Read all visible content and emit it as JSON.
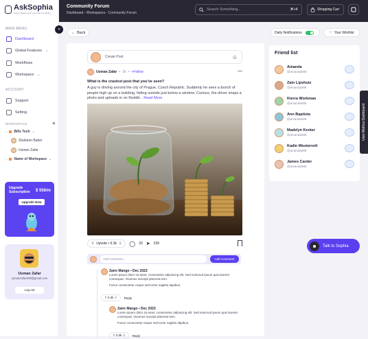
{
  "brand": {
    "name": "AskSophia",
    "tagline": "Inquiry Based New Look New Possibility"
  },
  "sidebar": {
    "main_menu_label": "MAIN MENU",
    "items": [
      {
        "label": "Dashboard",
        "icon": "dashboard-icon",
        "active": true
      },
      {
        "label": "Global Features",
        "icon": "globe-icon"
      },
      {
        "label": "Workflows",
        "icon": "workflow-icon"
      },
      {
        "label": "Workspace",
        "icon": "workspace-icon"
      }
    ],
    "account_label": "ACCOUNT",
    "account_items": [
      {
        "label": "Support",
        "icon": "support-icon"
      },
      {
        "label": "Setting",
        "icon": "gear-icon"
      }
    ],
    "workspace_label": "WORKSPACE",
    "workspaces": [
      {
        "label": "Bills Tech",
        "members": [
          "Shaheen Baber",
          "Usman Zafar"
        ]
      },
      {
        "label": "Name of Workspace"
      }
    ],
    "upgrade": {
      "title": "Upgrade Subscription",
      "price": "$ 556/m",
      "button": "Upgrade Now"
    },
    "user": {
      "name": "Usman Zafar",
      "email": "usmanzafar009@gmail.com",
      "logout": "Log out"
    }
  },
  "topbar": {
    "title": "Community Forum",
    "breadcrumb": "Dashboard - Workspaces - Community Forum",
    "search_placeholder": "Search Something...",
    "search_shortcut": "⌘+K",
    "cart_label": "Shopping Cart"
  },
  "toolbar": {
    "back": "Back",
    "notifications": "Daily Notifications",
    "notifications_on": true,
    "wishlist": "Your Wishlist"
  },
  "feed": {
    "create_post": "Create Post",
    "post": {
      "author": "Usman Zafar",
      "time": "1h",
      "follow": "Follow",
      "title": "What is the craziest post that you've seen?",
      "body": "A guy is driving around the city of Prague, Czech Republic. Suddenly he sees a bunch of people high up on a building, hiding outside just below a window. Curious, the driver snaps a photo and uploads in on Reddit...",
      "read_more": "Read More",
      "upvotes": "Upvote • 6.3k",
      "comments": "20",
      "shares": "239"
    },
    "comment_placeholder": "Add Comment...",
    "comment_button": "Add Comment",
    "comments": [
      {
        "who": "Zaire Mango • Dec 2023",
        "text": "Lorem ipsum dolor sit amet, consectetur adipiscing elit. Sed euismod ipsum quis laoreet consequat. Vivamus suscipit placerat sem.",
        "text2": "Fusce consectetur neque sed tortor sagittis dapibus.",
        "votes": "5.3k",
        "reply": "Reply"
      },
      {
        "who": "Zaire Mango • Dec 2023",
        "text": "Lorem ipsum dolor sit amet, consectetur adipiscing elit. Sed euismod ipsum quis laoreet consequat. Vivamus suscipit placerat sem.",
        "text2": "Fusce consectetur neque sed tortor sagittis dapibus.",
        "votes": "5.3k",
        "reply": "Reply"
      }
    ]
  },
  "friends": {
    "title": "Friend list",
    "list": [
      {
        "name": "Amanda",
        "handle": "@amanda089"
      },
      {
        "name": "Zain Lipshutz",
        "handle": "@amanda089"
      },
      {
        "name": "Kierra Workman",
        "handle": "@amanda089"
      },
      {
        "name": "Ann Baptista",
        "handle": "@amanda089"
      },
      {
        "name": "Madelyn Kenter",
        "handle": "@amanda089"
      },
      {
        "name": "Kadin Westervelt",
        "handle": "@amanda089"
      },
      {
        "name": "James Carder",
        "handle": "@amanda089"
      }
    ]
  },
  "side_tab": "User Metrics Dashboard",
  "talk_button": "Talk to Sophia",
  "colors": {
    "accent": "#5a3ff0",
    "topbar": "#2a2734",
    "upgrade_card": "#5b43f2"
  }
}
